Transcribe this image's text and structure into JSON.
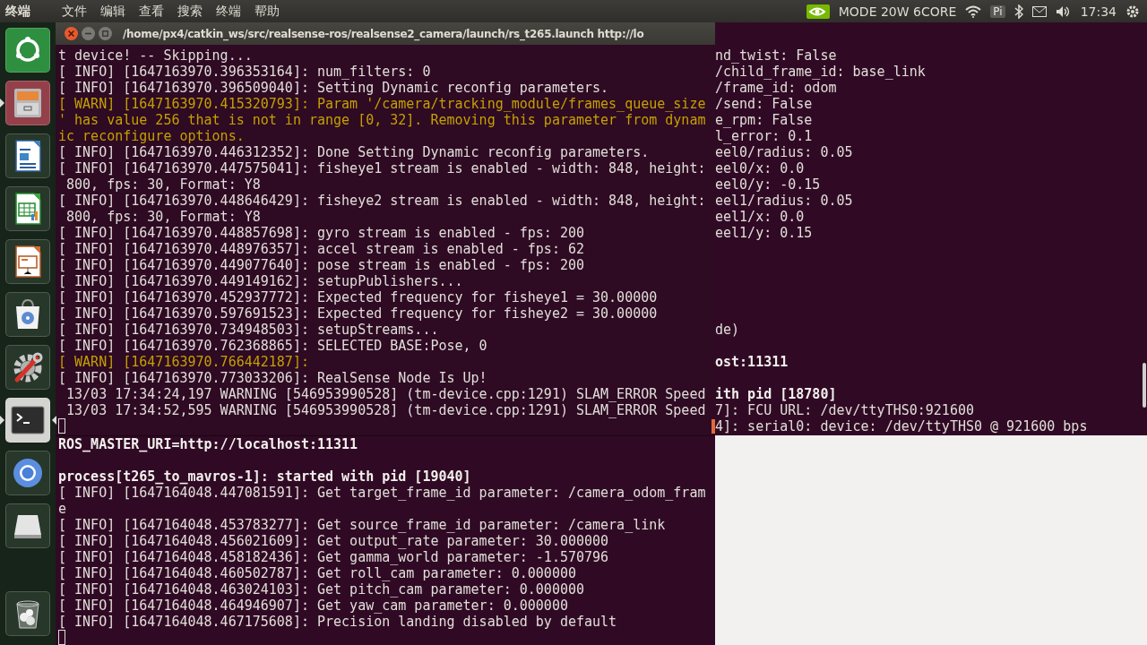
{
  "top_bar": {
    "app_name": "终端",
    "menu": [
      "文件",
      "编辑",
      "查看",
      "搜索",
      "终端",
      "帮助"
    ],
    "mode": "MODE 20W 6CORE",
    "input_method": "Pi",
    "clock": "17:34"
  },
  "dock": {
    "items": [
      {
        "kind": "home",
        "running": false,
        "focused": false
      },
      {
        "kind": "files",
        "running": true,
        "focused": false
      },
      {
        "kind": "writer",
        "running": false,
        "focused": false
      },
      {
        "kind": "calc",
        "running": false,
        "focused": false
      },
      {
        "kind": "impress",
        "running": false,
        "focused": false
      },
      {
        "kind": "store",
        "running": false,
        "focused": false
      },
      {
        "kind": "settings",
        "running": false,
        "focused": false
      },
      {
        "kind": "terminal",
        "running": true,
        "focused": true
      },
      {
        "kind": "browser",
        "running": false,
        "focused": false
      },
      {
        "kind": "drive",
        "running": false,
        "focused": false
      },
      {
        "kind": "trash",
        "running": false,
        "focused": false
      }
    ]
  },
  "terminal_window": {
    "title": "/home/px4/catkin_ws/src/realsense-ros/realsense2_camera/launch/rs_t265.launch http://lo",
    "lines": [
      {
        "kind": "normal",
        "text": "t device! -- Skipping..."
      },
      {
        "kind": "normal",
        "text": "[ INFO] [1647163970.396353164]: num_filters: 0"
      },
      {
        "kind": "normal",
        "text": "[ INFO] [1647163970.396509040]: Setting Dynamic reconfig parameters."
      },
      {
        "kind": "warn",
        "text": "[ WARN] [1647163970.415320793]: Param '/camera/tracking_module/frames_queue_size"
      },
      {
        "kind": "warn",
        "text": "' has value 256 that is not in range [0, 32]. Removing this parameter from dynam"
      },
      {
        "kind": "warn",
        "text": "ic reconfigure options."
      },
      {
        "kind": "normal",
        "text": "[ INFO] [1647163970.446312352]: Done Setting Dynamic reconfig parameters."
      },
      {
        "kind": "normal",
        "text": "[ INFO] [1647163970.447575041]: fisheye1 stream is enabled - width: 848, height:"
      },
      {
        "kind": "normal",
        "text": " 800, fps: 30, Format: Y8"
      },
      {
        "kind": "normal",
        "text": "[ INFO] [1647163970.448646429]: fisheye2 stream is enabled - width: 848, height:"
      },
      {
        "kind": "normal",
        "text": " 800, fps: 30, Format: Y8"
      },
      {
        "kind": "normal",
        "text": "[ INFO] [1647163970.448857698]: gyro stream is enabled - fps: 200"
      },
      {
        "kind": "normal",
        "text": "[ INFO] [1647163970.448976357]: accel stream is enabled - fps: 62"
      },
      {
        "kind": "normal",
        "text": "[ INFO] [1647163970.449077640]: pose stream is enabled - fps: 200"
      },
      {
        "kind": "normal",
        "text": "[ INFO] [1647163970.449149162]: setupPublishers..."
      },
      {
        "kind": "normal",
        "text": "[ INFO] [1647163970.452937772]: Expected frequency for fisheye1 = 30.00000"
      },
      {
        "kind": "normal",
        "text": "[ INFO] [1647163970.597691523]: Expected frequency for fisheye2 = 30.00000"
      },
      {
        "kind": "normal",
        "text": "[ INFO] [1647163970.734948503]: setupStreams..."
      },
      {
        "kind": "normal",
        "text": "[ INFO] [1647163970.762368865]: SELECTED BASE:Pose, 0"
      },
      {
        "kind": "warn",
        "text": "[ WARN] [1647163970.766442187]:"
      },
      {
        "kind": "normal",
        "text": "[ INFO] [1647163970.773033206]: RealSense Node Is Up!"
      },
      {
        "kind": "normal",
        "text": " 13/03 17:34:24,197 WARNING [546953990528] (tm-device.cpp:1291) SLAM_ERROR Speed"
      },
      {
        "kind": "normal",
        "text": " 13/03 17:34:52,595 WARNING [546953990528] (tm-device.cpp:1291) SLAM_ERROR Speed"
      },
      {
        "kind": "cursor"
      }
    ]
  },
  "back_terminal": {
    "lines": [
      {
        "kind": "normal",
        "text": "nd_twist: False"
      },
      {
        "kind": "normal",
        "text": "/child_frame_id: base_link"
      },
      {
        "kind": "normal",
        "text": "/frame_id: odom"
      },
      {
        "kind": "normal",
        "text": "/send: False"
      },
      {
        "kind": "normal",
        "text": "e_rpm: False"
      },
      {
        "kind": "normal",
        "text": "l_error: 0.1"
      },
      {
        "kind": "normal",
        "text": "eel0/radius: 0.05"
      },
      {
        "kind": "normal",
        "text": "eel0/x: 0.0"
      },
      {
        "kind": "normal",
        "text": "eel0/y: -0.15"
      },
      {
        "kind": "normal",
        "text": "eel1/radius: 0.05"
      },
      {
        "kind": "normal",
        "text": "eel1/x: 0.0"
      },
      {
        "kind": "normal",
        "text": "eel1/y: 0.15"
      },
      {
        "kind": "blank"
      },
      {
        "kind": "blank"
      },
      {
        "kind": "blank"
      },
      {
        "kind": "blank"
      },
      {
        "kind": "blank"
      },
      {
        "kind": "normal",
        "text": "de)"
      },
      {
        "kind": "blank"
      },
      {
        "kind": "bold",
        "text": "ost:11311"
      },
      {
        "kind": "blank"
      },
      {
        "kind": "bold",
        "text": "ith pid [18780]"
      },
      {
        "kind": "normal",
        "text": "7]: FCU URL: /dev/ttyTHS0:921600"
      },
      {
        "kind": "cursor_text",
        "text": "4]: serial0: device: /dev/ttyTHS0 @ 921600 bps"
      }
    ]
  },
  "bottom_terminal": {
    "lines": [
      {
        "kind": "bold",
        "text": "ROS_MASTER_URI=http://localhost:11311"
      },
      {
        "kind": "blank"
      },
      {
        "kind": "bold",
        "text": "process[t265_to_mavros-1]: started with pid [19040]"
      },
      {
        "kind": "normal",
        "text": "[ INFO] [1647164048.447081591]: Get target_frame_id parameter: /camera_odom_fram"
      },
      {
        "kind": "normal",
        "text": "e"
      },
      {
        "kind": "normal",
        "text": "[ INFO] [1647164048.453783277]: Get source_frame_id parameter: /camera_link"
      },
      {
        "kind": "normal",
        "text": "[ INFO] [1647164048.456021609]: Get output_rate parameter: 30.000000"
      },
      {
        "kind": "normal",
        "text": "[ INFO] [1647164048.458182436]: Get gamma_world parameter: -1.570796"
      },
      {
        "kind": "normal",
        "text": "[ INFO] [1647164048.460502787]: Get roll_cam parameter: 0.000000"
      },
      {
        "kind": "normal",
        "text": "[ INFO] [1647164048.463024103]: Get pitch_cam parameter: 0.000000"
      },
      {
        "kind": "normal",
        "text": "[ INFO] [1647164048.464946907]: Get yaw_cam parameter: 0.000000"
      },
      {
        "kind": "normal",
        "text": "[ INFO] [1647164048.467175608]: Precision landing disabled by default"
      },
      {
        "kind": "cursor"
      }
    ]
  }
}
